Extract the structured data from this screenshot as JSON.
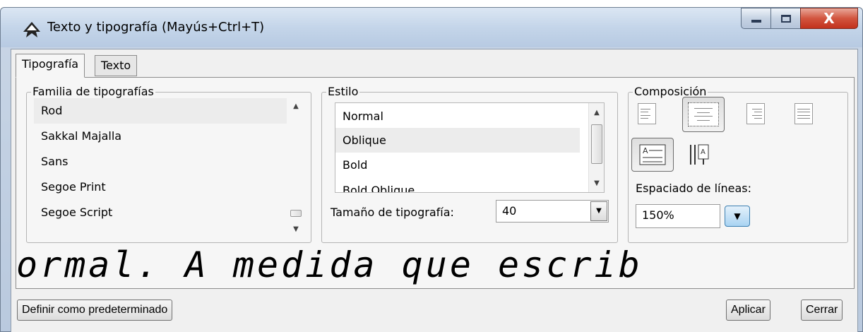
{
  "window": {
    "title": "Texto y tipografía (Mayús+Ctrl+T)",
    "minimize_glyph": "–",
    "maximize_glyph": "□",
    "close_glyph": "X"
  },
  "tabs": [
    {
      "label": "Tipografía",
      "active": true
    },
    {
      "label": "Texto",
      "active": false
    }
  ],
  "font_family": {
    "group_label": "Familia de tipografías",
    "items": [
      "Rod",
      "Sakkal Majalla",
      "Sans",
      "Segoe Print",
      "Segoe Script"
    ],
    "selected": "Rod"
  },
  "style": {
    "group_label": "Estilo",
    "items": [
      "Normal",
      "Oblique",
      "Bold",
      "Bold Oblique"
    ],
    "selected": "Oblique",
    "size_label": "Tamaño de tipografía:",
    "size_value": "40"
  },
  "layout": {
    "group_label": "Composición",
    "alignments": [
      "align-left",
      "align-center",
      "align-right",
      "align-justify"
    ],
    "selected_alignment": "align-center",
    "orientations": [
      "horizontal-text",
      "vertical-text"
    ],
    "selected_orientation": "horizontal-text",
    "line_spacing_label": "Espaciado de líneas:",
    "line_spacing_value": "150%"
  },
  "preview": {
    "text": "ormal. A medida que escrib"
  },
  "footer": {
    "set_default_label": "Definir como predeterminado",
    "apply_label": "Aplicar",
    "close_label": "Cerrar"
  }
}
